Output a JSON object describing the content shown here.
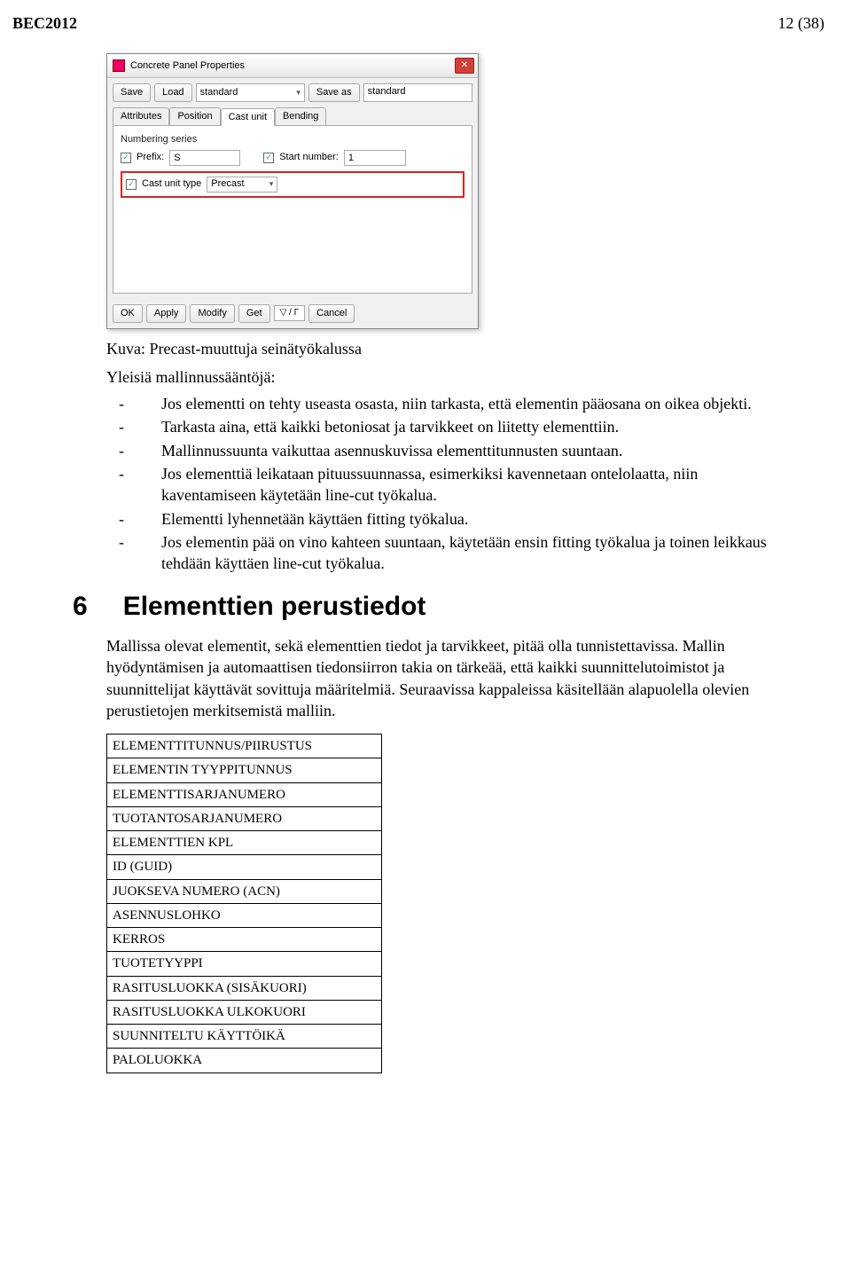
{
  "doc": {
    "header_left": "BEC2012",
    "header_right": "12 (38)"
  },
  "dialog": {
    "title": "Concrete Panel Properties",
    "btn_save": "Save",
    "btn_load": "Load",
    "preset_name": "standard",
    "btn_saveas": "Save as",
    "saveas_name": "standard",
    "tabs": {
      "attributes": "Attributes",
      "position": "Position",
      "castunit": "Cast unit",
      "bending": "Bending"
    },
    "numbering_label": "Numbering series",
    "prefix_label": "Prefix:",
    "prefix_value": "S",
    "start_label": "Start number:",
    "start_value": "1",
    "castunit_label": "Cast unit type",
    "castunit_value": "Precast",
    "btn_ok": "OK",
    "btn_apply": "Apply",
    "btn_modify": "Modify",
    "btn_get": "Get",
    "gamma": "▽ / Γ",
    "btn_cancel": "Cancel"
  },
  "caption": "Kuva: Precast-muuttuja seinätyökalussa",
  "list_heading": "Yleisiä mallinnussääntöjä:",
  "bullets": [
    "Jos elementti on tehty useasta osasta, niin tarkasta, että elementin pääosana on oikea objekti.",
    "Tarkasta aina, että kaikki betoniosat ja tarvikkeet on liitetty elementtiin.",
    "Mallinnussuunta vaikuttaa asennuskuvissa elementtitunnusten suuntaan.",
    "Jos elementtiä leikataan pituussuunnassa, esimerkiksi kavennetaan ontelolaatta, niin kaventamiseen käytetään line-cut työkalua.",
    "Elementti lyhennetään käyttäen fitting työkalua.",
    "Jos elementin pää on vino kahteen suuntaan, käytetään ensin fitting työkalua ja toinen leikkaus tehdään käyttäen line-cut työkalua."
  ],
  "section": {
    "num": "6",
    "title": "Elementtien perustiedot"
  },
  "para": "Mallissa olevat elementit, sekä elementtien tiedot ja tarvikkeet, pitää olla tunnistettavissa. Mallin hyödyntämisen ja automaattisen tiedonsiirron takia on tärkeää, että kaikki suunnittelutoimistot ja suunnittelijat käyttävät sovittuja määritelmiä. Seuraavissa kappaleissa käsitellään alapuolella olevien perustietojen merkitsemistä malliin.",
  "table_rows": [
    "ELEMENTTITUNNUS/PIIRUSTUS",
    "ELEMENTIN TYYPPITUNNUS",
    "ELEMENTTISARJANUMERO",
    "TUOTANTOSARJANUMERO",
    "ELEMENTTIEN KPL",
    "ID (GUID)",
    "JUOKSEVA NUMERO (ACN)",
    "ASENNUSLOHKO",
    "KERROS",
    "TUOTETYYPPI",
    "RASITUSLUOKKA (SISÄKUORI)",
    "RASITUSLUOKKA ULKOKUORI",
    "SUUNNITELTU KÄYTTÖIKÄ",
    "PALOLUOKKA"
  ]
}
